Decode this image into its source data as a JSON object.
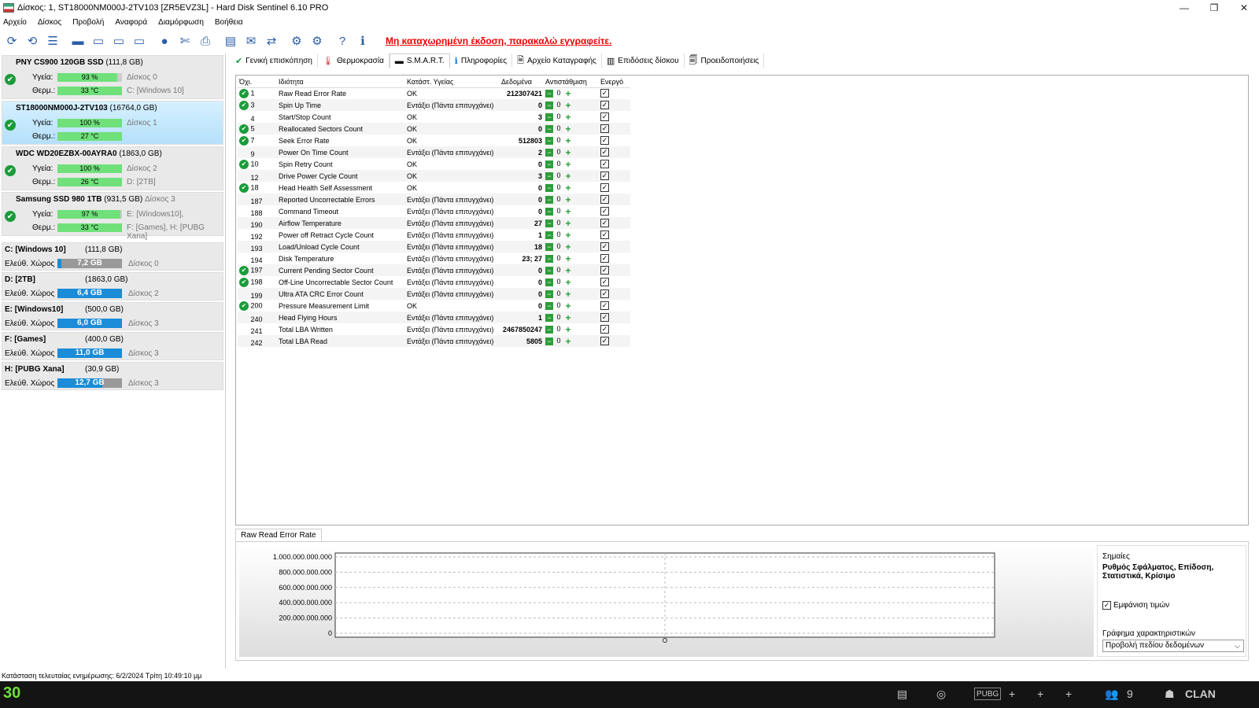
{
  "window": {
    "title": "Δίσκος: 1, ST18000NM000J-2TV103 [ZR5EVZ3L]  -  Hard Disk Sentinel 6.10 PRO",
    "min": "—",
    "max": "❐",
    "close": "✕"
  },
  "menu": [
    "Αρχείο",
    "Δίσκος",
    "Προβολή",
    "Αναφορά",
    "Διαμόρφωση",
    "Βοήθεια"
  ],
  "unregistered": "Μη καταχωρημένη έκδοση, παρακαλώ εγγραφείτε.",
  "disks": [
    {
      "name": "PNY CS900 120GB SSD",
      "size": "(111,8 GB)",
      "health_label": "Υγεία:",
      "health": "93 %",
      "health_pct": 93,
      "temp_label": "Θερμ.:",
      "temp": "33 °C",
      "temp_pct": 100,
      "disk_label": "Δίσκος 0",
      "volumes": "C: [Windows 10]",
      "extra2": "",
      "selected": false
    },
    {
      "name": "ST18000NM000J-2TV103",
      "size": "(16764,0 GB)",
      "health_label": "Υγεία:",
      "health": "100 %",
      "health_pct": 100,
      "temp_label": "Θερμ.:",
      "temp": "27 °C",
      "temp_pct": 100,
      "disk_label": "Δίσκος 1",
      "volumes": "",
      "extra2": "",
      "selected": true
    },
    {
      "name": "WDC WD20EZBX-00AYRA0",
      "size": "(1863,0 GB)",
      "health_label": "Υγεία:",
      "health": "100 %",
      "health_pct": 100,
      "temp_label": "Θερμ.:",
      "temp": "26 °C",
      "temp_pct": 100,
      "disk_label": "Δίσκος 2",
      "volumes": "D: [2TB]",
      "extra2": "",
      "selected": false
    },
    {
      "name": "Samsung SSD 980 1TB",
      "size": "(931,5 GB)",
      "size_extra": "Δίσκος 3",
      "health_label": "Υγεία:",
      "health": "97 %",
      "health_pct": 97,
      "temp_label": "Θερμ.:",
      "temp": "33 °C",
      "temp_pct": 100,
      "disk_label": "E: [Windows10],",
      "volumes": "F: [Games], H: [PUBG Xana]",
      "selected": false
    }
  ],
  "volumes": [
    {
      "name": "C: [Windows 10]",
      "size": "(111,8 GB)",
      "label": "Ελεύθ. Χώρος",
      "free": "7,2 GB",
      "free_pct": 6,
      "disk": "Δίσκος 0"
    },
    {
      "name": "D: [2TB]",
      "size": "(1863,0 GB)",
      "label": "Ελεύθ. Χώρος",
      "free": "6,4 GB",
      "free_pct": 100,
      "disk": "Δίσκος 2"
    },
    {
      "name": "E: [Windows10]",
      "size": "(500,0 GB)",
      "label": "Ελεύθ. Χώρος",
      "free": "6,0 GB",
      "free_pct": 100,
      "disk": "Δίσκος 3"
    },
    {
      "name": "F: [Games]",
      "size": "(400,0 GB)",
      "label": "Ελεύθ. Χώρος",
      "free": "11,0 GB",
      "free_pct": 100,
      "disk": "Δίσκος 3"
    },
    {
      "name": "H: [PUBG Xana]",
      "size": "(30,9 GB)",
      "label": "Ελεύθ. Χώρος",
      "free": "12,7 GB",
      "free_pct": 70,
      "disk": "Δίσκος 3"
    }
  ],
  "tabs": [
    {
      "label": "Γενική επισκόπηση",
      "icon": "✔",
      "active": false
    },
    {
      "label": "Θερμοκρασία",
      "icon": "🌡",
      "active": false
    },
    {
      "label": "S.M.A.R.T.",
      "icon": "▬",
      "active": true
    },
    {
      "label": "Πληροφορίες",
      "icon": "ℹ",
      "active": false
    },
    {
      "label": "Αρχείο Καταγραφής",
      "icon": "🗎",
      "active": false
    },
    {
      "label": "Επιδόσεις δίσκου",
      "icon": "📊",
      "active": false
    },
    {
      "label": "Προειδοποιήσεις",
      "icon": "🗐",
      "active": false
    }
  ],
  "smart_headers": [
    "Όχι.",
    "Ιδιότητα",
    "Κατάστ. Υγείας",
    "Δεδομένα",
    "Αντιστάθμιση",
    "Ενεργό"
  ],
  "smart_rows": [
    {
      "ok": true,
      "id": "1",
      "attr": "Raw Read Error Rate",
      "status": "OK",
      "data": "212307421",
      "offset": "0"
    },
    {
      "ok": true,
      "id": "3",
      "attr": "Spin Up Time",
      "status": "Εντάξει (Πάντα επιτυγχάνει)",
      "data": "0",
      "offset": "0"
    },
    {
      "ok": false,
      "id": "4",
      "attr": "Start/Stop Count",
      "status": "OK",
      "data": "3",
      "offset": "0"
    },
    {
      "ok": true,
      "id": "5",
      "attr": "Reallocated Sectors Count",
      "status": "OK",
      "data": "0",
      "offset": "0"
    },
    {
      "ok": true,
      "id": "7",
      "attr": "Seek Error Rate",
      "status": "OK",
      "data": "512803",
      "offset": "0"
    },
    {
      "ok": false,
      "id": "9",
      "attr": "Power On Time Count",
      "status": "Εντάξει (Πάντα επιτυγχάνει)",
      "data": "2",
      "offset": "0"
    },
    {
      "ok": true,
      "id": "10",
      "attr": "Spin Retry Count",
      "status": "OK",
      "data": "0",
      "offset": "0"
    },
    {
      "ok": false,
      "id": "12",
      "attr": "Drive Power Cycle Count",
      "status": "OK",
      "data": "3",
      "offset": "0"
    },
    {
      "ok": true,
      "id": "18",
      "attr": "Head Health Self Assessment",
      "status": "OK",
      "data": "0",
      "offset": "0"
    },
    {
      "ok": false,
      "id": "187",
      "attr": "Reported Uncorrectable Errors",
      "status": "Εντάξει (Πάντα επιτυγχάνει)",
      "data": "0",
      "offset": "0"
    },
    {
      "ok": false,
      "id": "188",
      "attr": "Command Timeout",
      "status": "Εντάξει (Πάντα επιτυγχάνει)",
      "data": "0",
      "offset": "0"
    },
    {
      "ok": false,
      "id": "190",
      "attr": "Airflow Temperature",
      "status": "Εντάξει (Πάντα επιτυγχάνει)",
      "data": "27",
      "offset": "0"
    },
    {
      "ok": false,
      "id": "192",
      "attr": "Power off Retract Cycle Count",
      "status": "Εντάξει (Πάντα επιτυγχάνει)",
      "data": "1",
      "offset": "0"
    },
    {
      "ok": false,
      "id": "193",
      "attr": "Load/Unload Cycle Count",
      "status": "Εντάξει (Πάντα επιτυγχάνει)",
      "data": "18",
      "offset": "0"
    },
    {
      "ok": false,
      "id": "194",
      "attr": "Disk Temperature",
      "status": "Εντάξει (Πάντα επιτυγχάνει)",
      "data": "23; 27",
      "offset": "0"
    },
    {
      "ok": true,
      "id": "197",
      "attr": "Current Pending Sector Count",
      "status": "Εντάξει (Πάντα επιτυγχάνει)",
      "data": "0",
      "offset": "0"
    },
    {
      "ok": true,
      "id": "198",
      "attr": "Off-Line Uncorrectable Sector Count",
      "status": "Εντάξει (Πάντα επιτυγχάνει)",
      "data": "0",
      "offset": "0"
    },
    {
      "ok": false,
      "id": "199",
      "attr": "Ultra ATA CRC Error Count",
      "status": "Εντάξει (Πάντα επιτυγχάνει)",
      "data": "0",
      "offset": "0"
    },
    {
      "ok": true,
      "id": "200",
      "attr": "Pressure Measurement Limit",
      "status": "OK",
      "data": "0",
      "offset": "0"
    },
    {
      "ok": false,
      "id": "240",
      "attr": "Head Flying Hours",
      "status": "Εντάξει (Πάντα επιτυγχάνει)",
      "data": "1",
      "offset": "0"
    },
    {
      "ok": false,
      "id": "241",
      "attr": "Total LBA Written",
      "status": "Εντάξει (Πάντα επιτυγχάνει)",
      "data": "2467850247",
      "offset": "0"
    },
    {
      "ok": false,
      "id": "242",
      "attr": "Total LBA Read",
      "status": "Εντάξει (Πάντα επιτυγχάνει)",
      "data": "5805",
      "offset": "0"
    }
  ],
  "graph_tab": "Raw Read Error Rate",
  "chart_data": {
    "type": "line",
    "yticks": [
      "1.000.000.000.000",
      "800.000.000.000",
      "600.000.000.000",
      "400.000.000.000",
      "200.000.000.000",
      "0"
    ],
    "ylim": [
      0,
      1000000000000
    ],
    "grid": true
  },
  "side": {
    "flags_label": "Σημαίες",
    "flags_value": "Ρυθμός Σφάλματος, Επίδοση, Στατιστικά, Κρίσιμο",
    "show_values": "Εμφάνιση τιμών",
    "chart_label": "Γράφημα χαρακτηριστικών",
    "chart_select": "Προβολή πεδίου δεδομένων"
  },
  "status": "Κατάσταση τελευταίας ενημέρωσης: 6/2/2024 Τρίτη 10:49:10 μμ",
  "taskbar": {
    "fps": "30",
    "game_label": "PUBG",
    "players": "9",
    "clan": "CLAN"
  }
}
